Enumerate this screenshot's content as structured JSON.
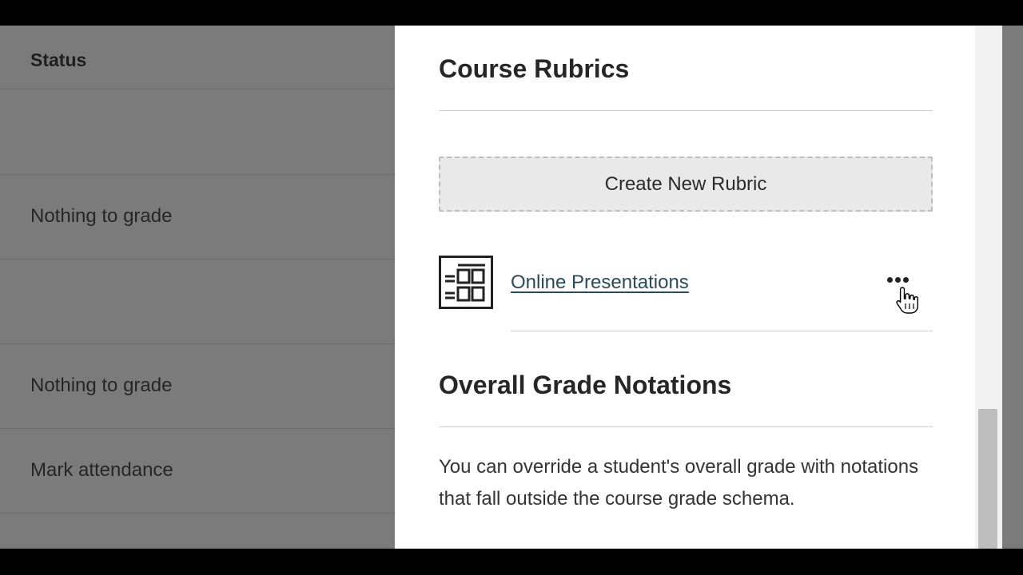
{
  "left_table": {
    "header": "Status",
    "rows": [
      "",
      "Nothing to grade",
      "",
      "Nothing to grade",
      "Mark attendance",
      "..."
    ]
  },
  "panel": {
    "rubrics_title": "Course Rubrics",
    "create_button_label": "Create New Rubric",
    "rubric_items": [
      {
        "name": "Online Presentations",
        "icon": "rubric-grid-icon",
        "more_icon": "more-options-icon"
      }
    ],
    "notations_title": "Overall Grade Notations",
    "notations_description": "You can override a student's overall grade with notations that fall outside the course grade schema."
  },
  "colors": {
    "overlay": "#7b7b7b",
    "panel_bg": "#ffffff",
    "link": "#2a4a58",
    "button_bg": "#e9e9e9"
  }
}
